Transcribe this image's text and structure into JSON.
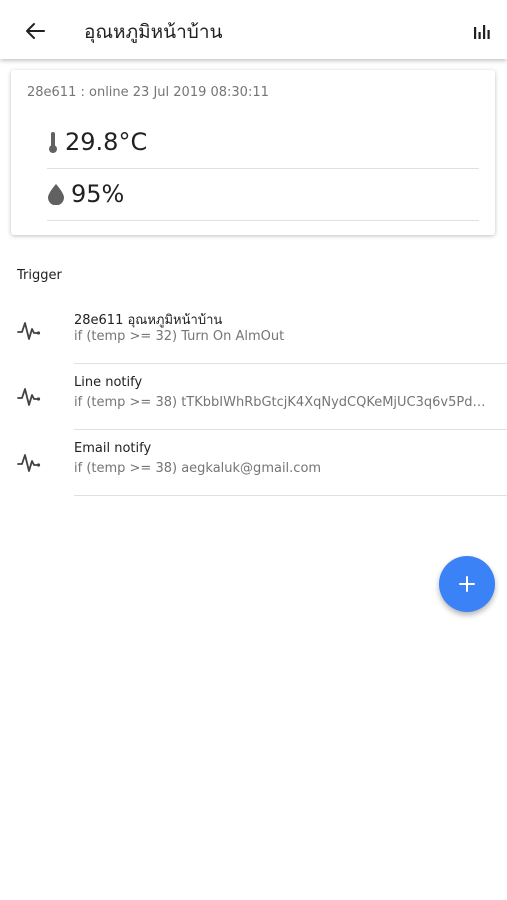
{
  "appbar": {
    "title": "อุณหภูมิหน้าบ้าน",
    "back_icon": "arrow-left-icon",
    "chart_icon": "bar-chart-icon"
  },
  "sensor_card": {
    "status": "28e611 : online 23 Jul 2019 08:30:11",
    "temperature": "29.8°C",
    "temperature_icon": "thermometer-icon",
    "humidity": "95%",
    "humidity_icon": "water-drop-icon"
  },
  "triggers_section": {
    "label": "Trigger",
    "items": [
      {
        "title": "28e611 อุณหภูมิหน้าบ้าน",
        "condition": "if (temp >= 32) Turn On AlmOut",
        "icon": "pulse-icon"
      },
      {
        "title": "Line notify",
        "condition": "if (temp >= 38) tTKbbIWhRbGtcjK4XqNydCQKeMjUC3q6v5Pd5d...",
        "icon": "pulse-icon"
      },
      {
        "title": "Email notify",
        "condition": "if (temp >= 38) aegkaluk@gmail.com",
        "icon": "pulse-icon"
      }
    ]
  },
  "fab": {
    "icon": "plus-icon"
  },
  "colors": {
    "accent": "#3b82f6",
    "divider": "#e0e0e0",
    "secondary_text": "#757575"
  }
}
